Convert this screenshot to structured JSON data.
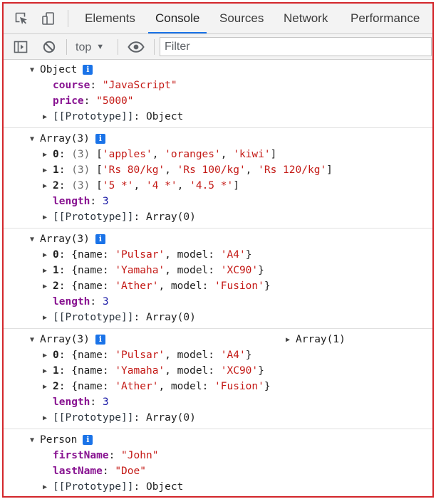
{
  "tabs": [
    {
      "label": "Elements",
      "active": false
    },
    {
      "label": "Console",
      "active": true
    },
    {
      "label": "Sources",
      "active": false
    },
    {
      "label": "Network",
      "active": false
    },
    {
      "label": "Performance",
      "active": false
    }
  ],
  "toolbar": {
    "context": "top",
    "filter_placeholder": "Filter"
  },
  "accent_color": "#1a73e8",
  "entries": [
    {
      "label": "Object",
      "lines": [
        {
          "key": "course",
          "sep": ": ",
          "value": "\"JavaScript\""
        },
        {
          "key": "price",
          "sep": ": ",
          "value": "\"5000\""
        },
        {
          "key": "[[Prototype]]",
          "sep": ": ",
          "value": "Object"
        }
      ]
    },
    {
      "label": "Array(3)",
      "lines": [
        {
          "key": "0",
          "sep": ": ",
          "count": "(3) ",
          "value": [
            "'apples'",
            "'oranges'",
            "'kiwi'"
          ]
        },
        {
          "key": "1",
          "sep": ": ",
          "count": "(3) ",
          "value": [
            "'Rs 80/kg'",
            "'Rs 100/kg'",
            "'Rs 120/kg'"
          ]
        },
        {
          "key": "2",
          "sep": ": ",
          "count": "(3) ",
          "value": [
            "'5 *'",
            "'4 *'",
            "'4.5 *'"
          ]
        },
        {
          "key": "length",
          "sep": ": ",
          "value": "3"
        },
        {
          "key": "[[Prototype]]",
          "sep": ": ",
          "value": "Array(0)"
        }
      ]
    },
    {
      "label": "Array(3)",
      "lines": [
        {
          "key": "0",
          "sep": ": ",
          "name": "'Pulsar'",
          "model": "'A4'"
        },
        {
          "key": "1",
          "sep": ": ",
          "name": "'Yamaha'",
          "model": "'XC90'"
        },
        {
          "key": "2",
          "sep": ": ",
          "name": "'Ather'",
          "model": "'Fusion'"
        },
        {
          "key": "length",
          "sep": ": ",
          "value": "3"
        },
        {
          "key": "[[Prototype]]",
          "sep": ": ",
          "value": "Array(0)"
        }
      ]
    },
    {
      "label": "Array(3)",
      "aside": "Array(1)",
      "lines": [
        {
          "key": "0",
          "sep": ": ",
          "name": "'Pulsar'",
          "model": "'A4'"
        },
        {
          "key": "1",
          "sep": ": ",
          "name": "'Yamaha'",
          "model": "'XC90'"
        },
        {
          "key": "2",
          "sep": ": ",
          "name": "'Ather'",
          "model": "'Fusion'"
        },
        {
          "key": "length",
          "sep": ": ",
          "value": "3"
        },
        {
          "key": "[[Prototype]]",
          "sep": ": ",
          "value": "Array(0)"
        }
      ]
    },
    {
      "label": "Person",
      "lines": [
        {
          "key": "firstName",
          "sep": ": ",
          "value": "\"John\""
        },
        {
          "key": "lastName",
          "sep": ": ",
          "value": "\"Doe\""
        },
        {
          "key": "[[Prototype]]",
          "sep": ": ",
          "value": "Object"
        }
      ]
    }
  ],
  "tokens": {
    "name_key": "name",
    "model_key": "model",
    "colon_sep": ": ",
    "comma_sep": ", ",
    "open_brace": "{",
    "close_brace": "}",
    "open_bracket": "[",
    "close_bracket": "]",
    "info_badge": "i"
  }
}
